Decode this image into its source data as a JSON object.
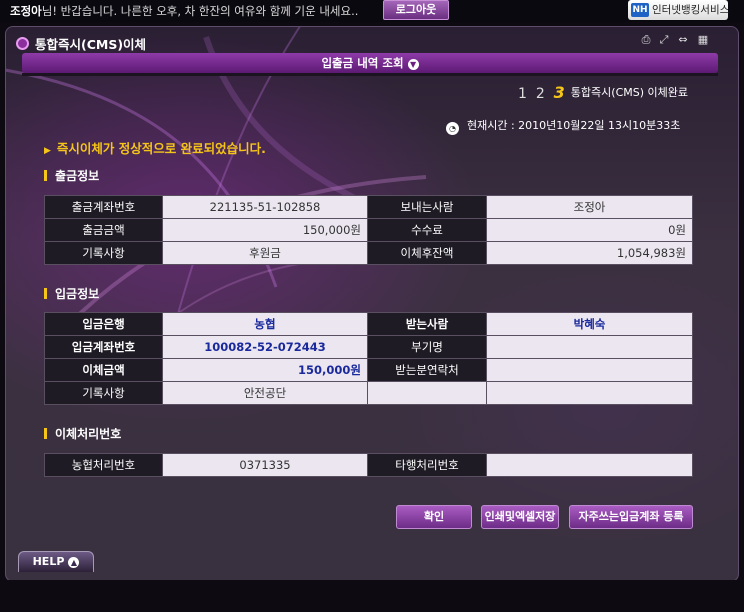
{
  "topbar": {
    "user_name": "조정아",
    "greeting": "님! 반갑습니다. 나른한 오후, 차 한잔의 여유와 함께 기운 내세요..",
    "logout_label": "로그아웃",
    "nh_mark": "NH",
    "nh_service_label": "인터넷뱅킹서비스"
  },
  "panel": {
    "title": "통합즉시(CMS)이체",
    "subnav_label": "입출금 내역 조회",
    "steps": [
      "1",
      "2",
      "3"
    ],
    "current_step": "3",
    "step_label": "통합즉시(CMS) 이체완료",
    "current_time_label": "현재시간 : 2010년10월22일 13시10분33초",
    "done_message": "즉시이체가 정상적으로 완료되었습니다."
  },
  "withdrawal": {
    "section_title": "출금정보",
    "rows": [
      [
        "출금계좌번호",
        "221135-51-102858",
        "보내는사람",
        "조정아"
      ],
      [
        "출금금액",
        "150,000원",
        "수수료",
        "0원"
      ],
      [
        "기록사항",
        "후원금",
        "이체후잔액",
        "1,054,983원"
      ]
    ]
  },
  "deposit": {
    "section_title": "입금정보",
    "rows": [
      [
        "입금은행",
        "농협",
        "받는사람",
        "박혜숙"
      ],
      [
        "입금계좌번호",
        "100082-52-072443",
        "부기명",
        ""
      ],
      [
        "이체금액",
        "150,000원",
        "받는분연락처",
        ""
      ],
      [
        "기록사항",
        "안전공단",
        "",
        ""
      ]
    ]
  },
  "processing": {
    "section_title": "이체처리번호",
    "rows": [
      [
        "농협처리번호",
        "0371335",
        "타행처리번호",
        ""
      ]
    ]
  },
  "buttons": {
    "confirm": "확인",
    "print_excel": "인쇄및엑셀저장",
    "register_account": "자주쓰는입금계좌 등록"
  },
  "help_label": "HELP",
  "colors": {
    "accent": "#8e3aa8",
    "highlight": "#f5c518",
    "value_bg": "#ebe6f0",
    "label_bg": "#1e1b24"
  }
}
